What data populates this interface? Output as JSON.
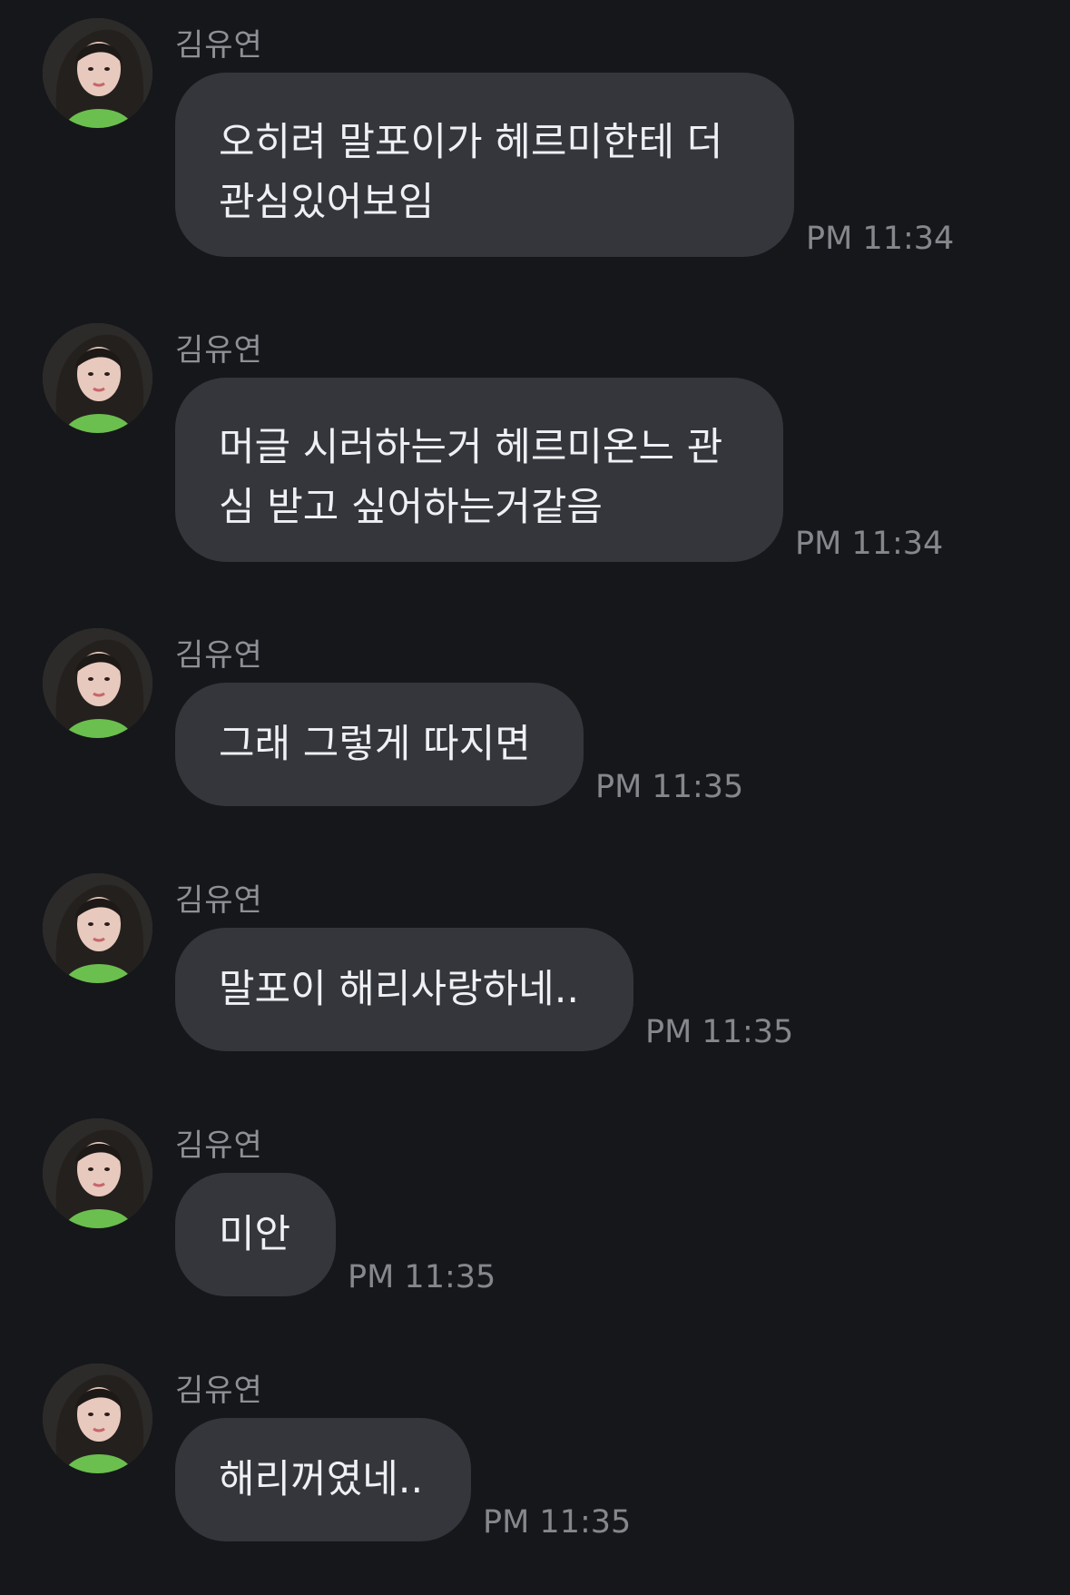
{
  "accent": {
    "background": "#16171b",
    "bubble": "#34363c",
    "sender_text": "#8e9096",
    "time_text": "#85878d"
  },
  "messages": [
    {
      "sender": "김유연",
      "avatar_icon": "profile-photo",
      "text": "오히려 말포이가 헤르미한테 더\n관심있어보임",
      "time": "PM 11:34"
    },
    {
      "sender": "김유연",
      "avatar_icon": "profile-photo",
      "text": "머글 시러하는거 헤르미온느 관\n심 받고 싶어하는거같음",
      "time": "PM 11:34"
    },
    {
      "sender": "김유연",
      "avatar_icon": "profile-photo",
      "text": "그래 그렇게 따지면",
      "time": "PM 11:35"
    },
    {
      "sender": "김유연",
      "avatar_icon": "profile-photo",
      "text": "말포이 해리사랑하네..",
      "time": "PM 11:35"
    },
    {
      "sender": "김유연",
      "avatar_icon": "profile-photo",
      "text": "미안",
      "time": "PM 11:35"
    },
    {
      "sender": "김유연",
      "avatar_icon": "profile-photo",
      "text": "해리꺼였네..",
      "time": "PM 11:35"
    }
  ]
}
